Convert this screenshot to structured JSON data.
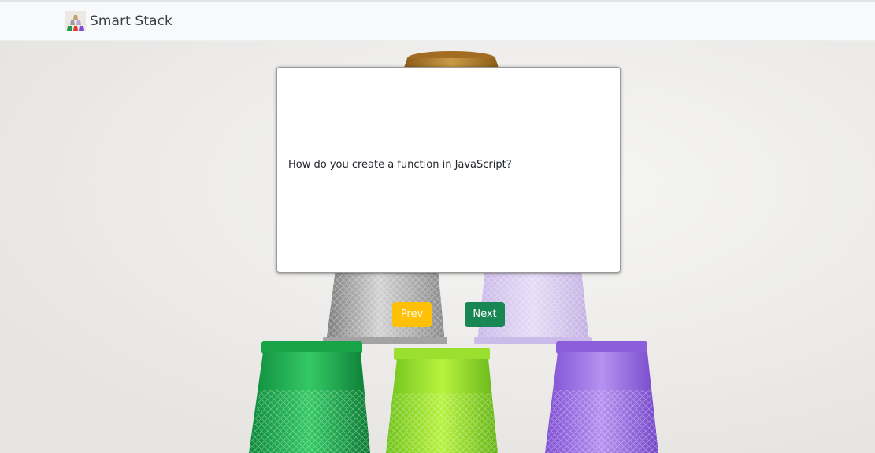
{
  "navbar": {
    "brand_name": "Smart Stack",
    "logo_icon": "stacked-cups-logo-icon"
  },
  "flashcard": {
    "question": "How do you create a function in JavaScript?"
  },
  "controls": {
    "prev_label": "Prev",
    "next_label": "Next"
  },
  "background": {
    "subject": "stacked-plastic-cups-photo"
  },
  "colors": {
    "prev_button": "#ffc107",
    "next_button": "#198754",
    "navbar_bg": "#f8f9fa"
  }
}
